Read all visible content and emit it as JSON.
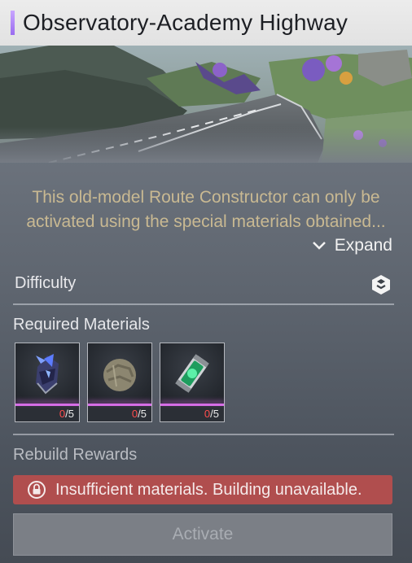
{
  "header": {
    "title": "Observatory-Academy Highway"
  },
  "description": {
    "text": "This old-model Route Constructor can only be activated using the special materials obtained...",
    "expand_label": "Expand"
  },
  "difficulty": {
    "label": "Difficulty",
    "icon": "difficulty-icon"
  },
  "materials": {
    "label": "Required Materials",
    "items": [
      {
        "name": "crystal-shard-icon",
        "have": "0",
        "need": "/5"
      },
      {
        "name": "stone-orb-icon",
        "have": "0",
        "need": "/5"
      },
      {
        "name": "energy-canister-icon",
        "have": "0",
        "need": "/5"
      }
    ]
  },
  "rewards": {
    "label": "Rebuild Rewards"
  },
  "warning": {
    "text": "Insufficient materials. Building unavailable.",
    "icon": "lock-icon"
  },
  "activate": {
    "label": "Activate"
  },
  "colors": {
    "accent": "#b48cff",
    "warning_bg": "#b04e4e",
    "count_short": "#ff4d4d",
    "rarity_bar": "#d66de6",
    "description_text": "#c9b992"
  }
}
